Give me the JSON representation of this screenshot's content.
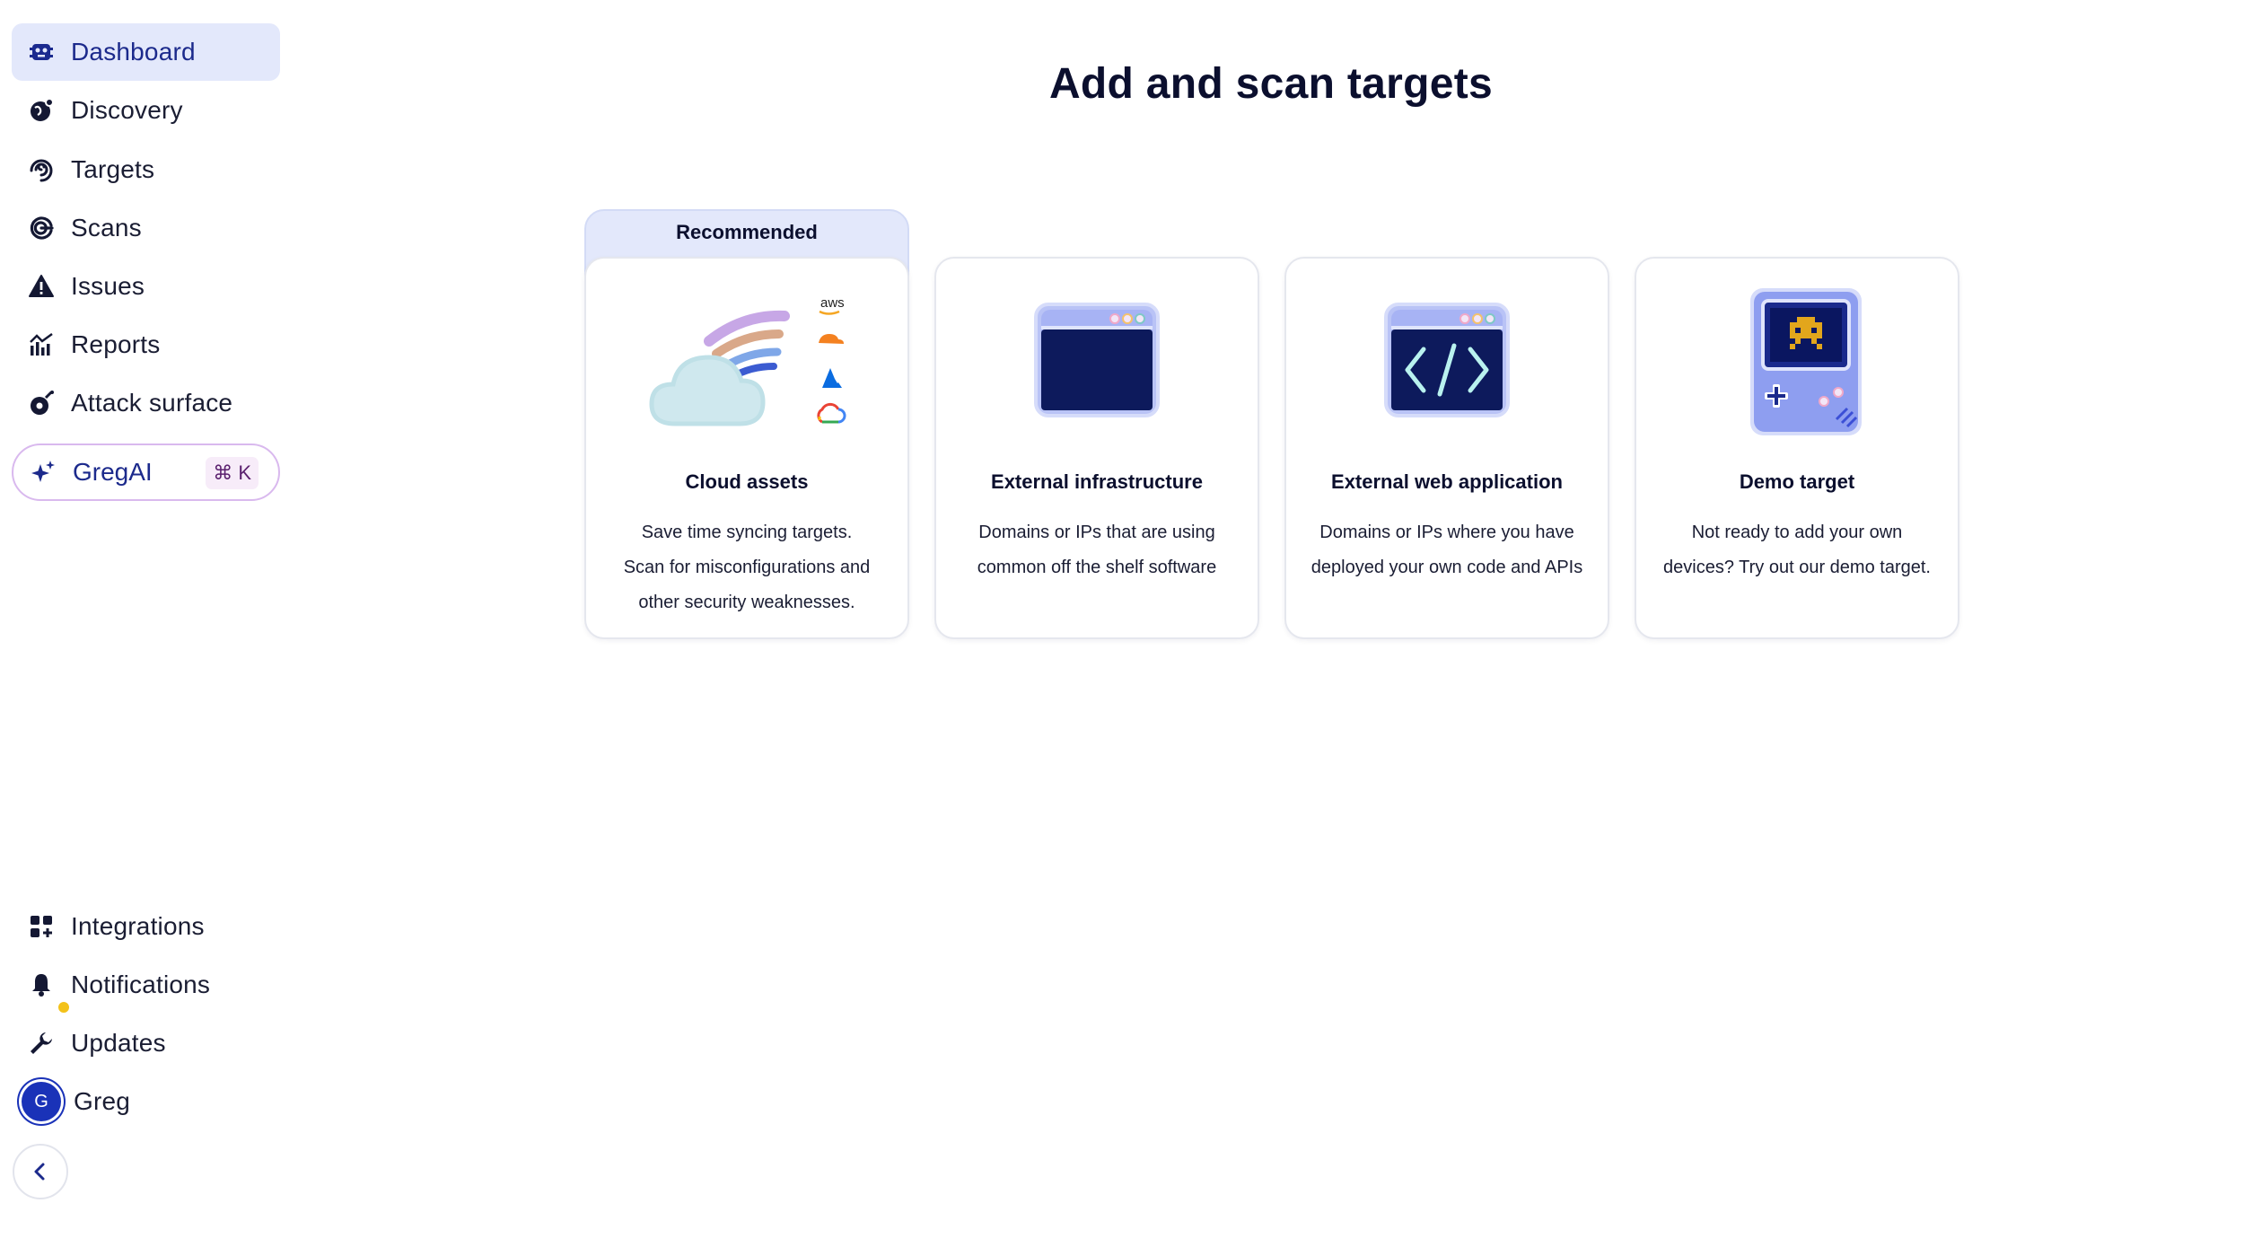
{
  "sidebar": {
    "items": [
      {
        "label": "Dashboard",
        "icon": "dashboard-icon",
        "active": true
      },
      {
        "label": "Discovery",
        "icon": "globe-icon"
      },
      {
        "label": "Targets",
        "icon": "target-spiral-icon"
      },
      {
        "label": "Scans",
        "icon": "scan-icon"
      },
      {
        "label": "Issues",
        "icon": "warning-icon"
      },
      {
        "label": "Reports",
        "icon": "chart-icon"
      },
      {
        "label": "Attack surface",
        "icon": "bomb-icon"
      }
    ],
    "ai": {
      "label": "GregAI",
      "shortcut": "⌘ K",
      "icon": "sparkle-icon"
    },
    "bottom_items": [
      {
        "label": "Integrations",
        "icon": "grid-plus-icon"
      },
      {
        "label": "Notifications",
        "icon": "bell-icon"
      },
      {
        "label": "Updates",
        "icon": "wrench-icon"
      }
    ],
    "user": {
      "name": "Greg",
      "initial": "G"
    },
    "collapse_icon": "chevron-left-icon"
  },
  "main": {
    "title": "Add and scan targets",
    "recommended_label": "Recommended",
    "cards": [
      {
        "title": "Cloud assets",
        "lines": [
          "Save time syncing targets.",
          "Scan for misconfigurations and",
          "other security weaknesses."
        ],
        "icon": "cloud-icon",
        "provider_text": "aws"
      },
      {
        "title": "External infrastructure",
        "lines": [
          "Domains or IPs that are using",
          "common off the shelf software"
        ],
        "icon": "browser-window-icon"
      },
      {
        "title": "External web application",
        "lines": [
          "Domains or IPs where you have",
          "deployed your own code and APIs"
        ],
        "icon": "code-window-icon"
      },
      {
        "title": "Demo target",
        "lines": [
          "Not ready to add your own",
          "devices? Try out our demo target."
        ],
        "icon": "game-console-icon"
      }
    ]
  },
  "colors": {
    "accent": "#1c2a8c",
    "active_bg": "#e3e8fb",
    "ai_border": "#d9b9ee"
  }
}
